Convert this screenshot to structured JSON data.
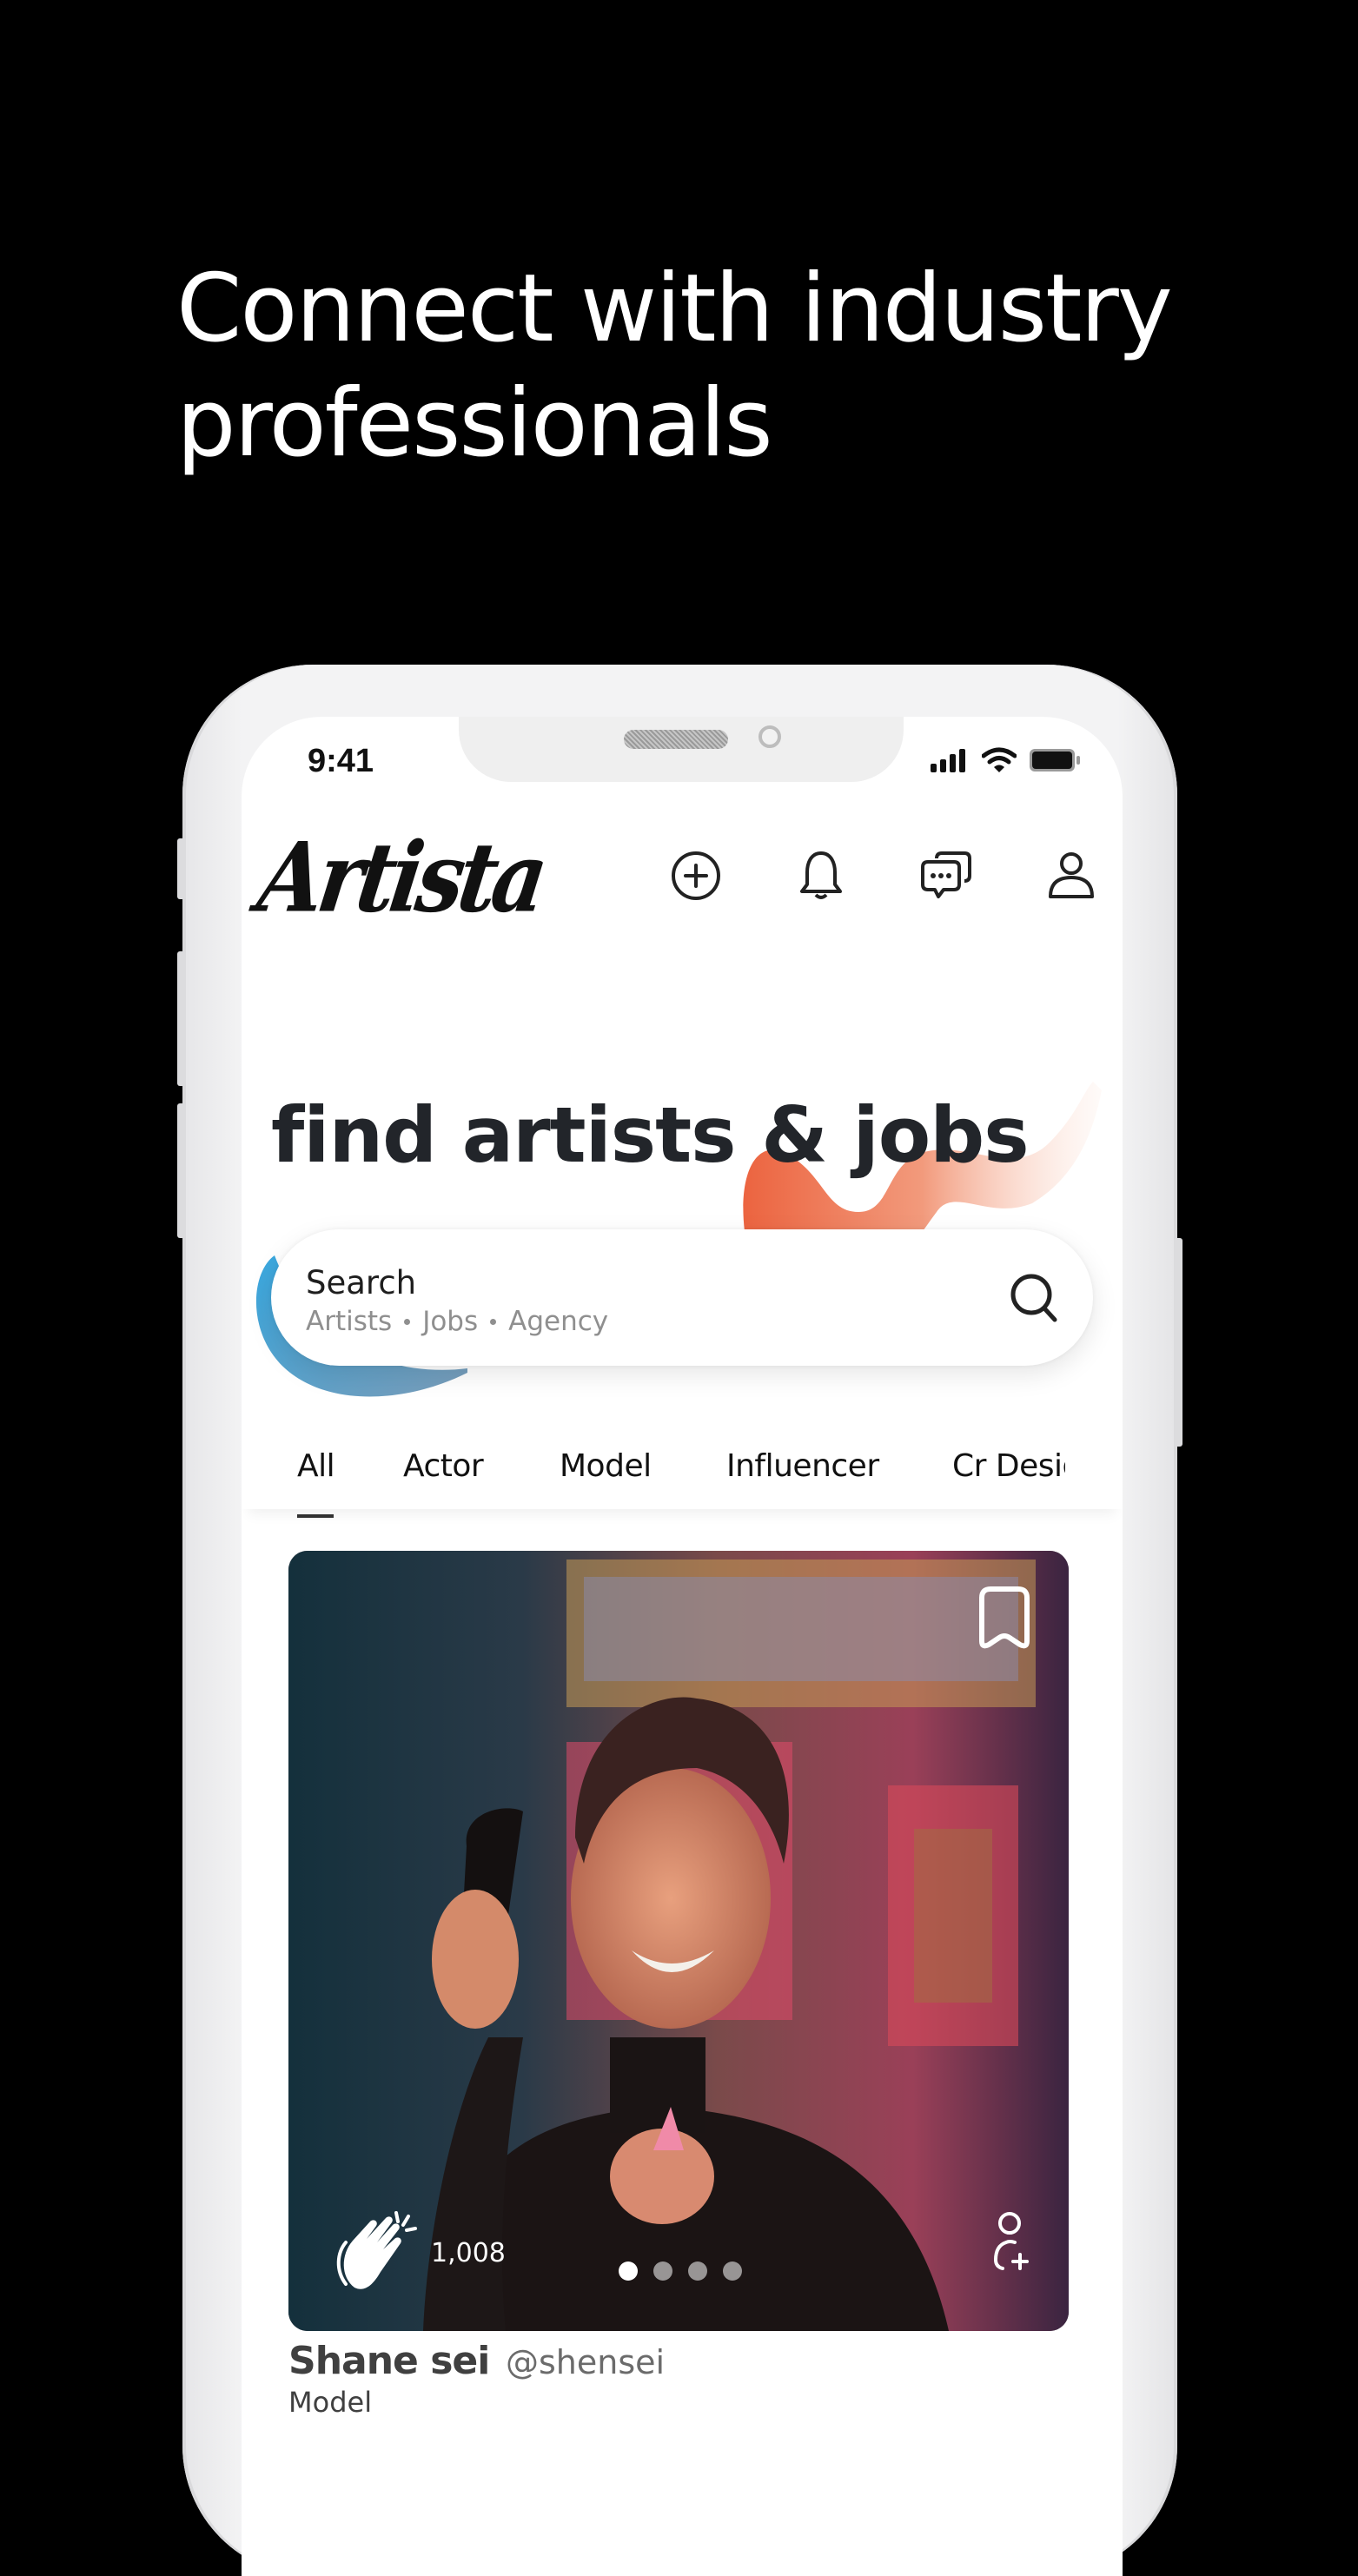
{
  "headline": {
    "line1": "Connect with industry",
    "line2": "professionals"
  },
  "status_bar": {
    "time": "9:41",
    "icons": [
      "cellular-signal-icon",
      "wifi-icon",
      "battery-icon"
    ]
  },
  "app": {
    "logo": "Artista",
    "header_icons": [
      "add-circle-icon",
      "bell-icon",
      "chat-bubbles-icon",
      "user-icon"
    ],
    "hero_title": "find artists & jobs",
    "search": {
      "label": "Search",
      "hints": [
        "Artists",
        "Jobs",
        "Agency"
      ]
    },
    "tabs": [
      {
        "label": "All",
        "active": true
      },
      {
        "label": "Actor",
        "active": false
      },
      {
        "label": "Model",
        "active": false
      },
      {
        "label": "Influencer",
        "active": false
      },
      {
        "label": "Cr Desig",
        "active": false
      }
    ],
    "card": {
      "claps": "1,008",
      "image_count": 4,
      "active_image": 1,
      "name": "Shane sei",
      "handle": "@shensei",
      "role": "Model"
    }
  },
  "colors": {
    "accent_orange": "#ee6a45",
    "accent_blue": "#3aa3dc",
    "text_dark": "#22252a"
  }
}
